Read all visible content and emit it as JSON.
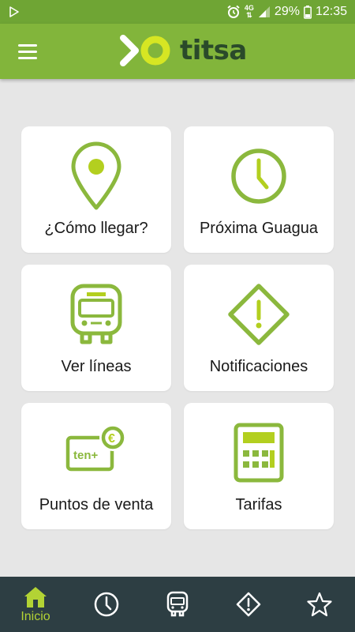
{
  "status_bar": {
    "battery": "29%",
    "time": "12:35",
    "network": "4G"
  },
  "app_bar": {
    "logo_text": "titsa"
  },
  "menu_items": [
    {
      "label": "¿Cómo llegar?",
      "icon": "location-pin-icon"
    },
    {
      "label": "Próxima Guagua",
      "icon": "clock-icon"
    },
    {
      "label": "Ver líneas",
      "icon": "bus-icon"
    },
    {
      "label": "Notificaciones",
      "icon": "warning-diamond-icon"
    },
    {
      "label": "Puntos de venta",
      "icon": "ticket-euro-icon",
      "ticket_text": "ten+",
      "currency": "€"
    },
    {
      "label": "Tarifas",
      "icon": "calculator-icon"
    }
  ],
  "bottom_nav": {
    "items": [
      {
        "label": "Inicio",
        "icon": "home-icon",
        "active": true
      },
      {
        "icon": "clock-icon"
      },
      {
        "icon": "bus-icon"
      },
      {
        "icon": "warning-icon"
      },
      {
        "icon": "star-icon"
      }
    ]
  },
  "colors": {
    "status_bar": "#6fa534",
    "app_bar": "#82b53b",
    "accent": "#8bb83d",
    "dot": "#b3cf1f",
    "background": "#e6e6e6",
    "bottom_nav": "#2d3e43",
    "nav_active": "#b3d334"
  }
}
